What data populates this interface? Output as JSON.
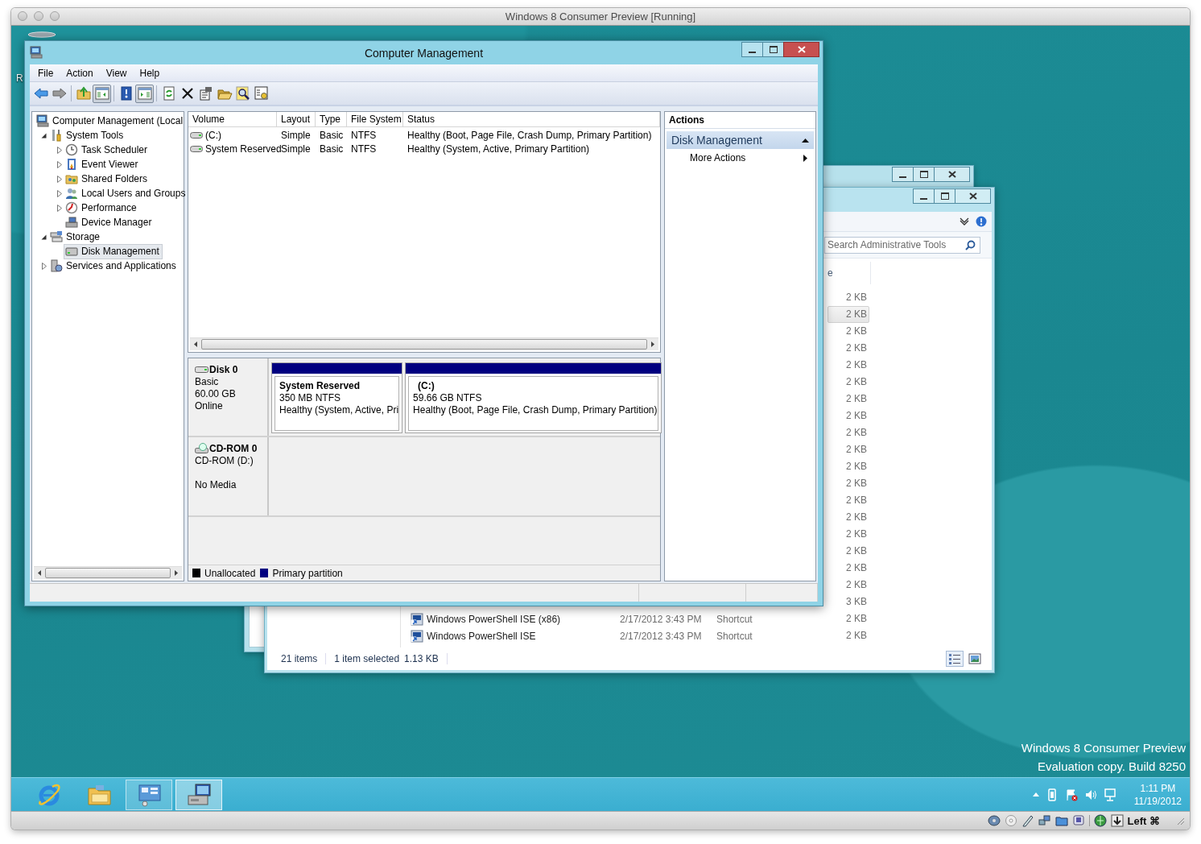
{
  "vm_window": {
    "title": "Windows 8 Consumer Preview [Running]"
  },
  "desktop": {
    "icon_labels": [
      "R"
    ],
    "notice_lines": [
      "Windows 8 Consumer Preview",
      "Evaluation copy. Build 8250"
    ]
  },
  "computer_management": {
    "title": "Computer Management",
    "menu": [
      "File",
      "Action",
      "View",
      "Help"
    ],
    "toolbar_groups": [
      {
        "buttons": [
          {
            "kind": "back",
            "pressed": false
          },
          {
            "kind": "forward",
            "pressed": false
          }
        ]
      },
      {
        "buttons": [
          {
            "kind": "up",
            "pressed": false
          },
          {
            "kind": "console-tree",
            "pressed": true
          }
        ]
      },
      {
        "buttons": [
          {
            "kind": "help",
            "pressed": false
          },
          {
            "kind": "action-pane",
            "pressed": true
          }
        ]
      },
      {
        "buttons": [
          {
            "kind": "refresh",
            "pressed": false
          },
          {
            "kind": "delete",
            "pressed": false
          },
          {
            "kind": "properties",
            "pressed": false
          },
          {
            "kind": "open",
            "pressed": false
          },
          {
            "kind": "search",
            "pressed": false
          },
          {
            "kind": "settings",
            "pressed": false
          }
        ]
      }
    ],
    "tree": [
      {
        "label": "Computer Management (Local",
        "kind": "computer",
        "selected": false,
        "children": [
          {
            "label": "System Tools",
            "kind": "tools",
            "expanded": true,
            "selected": false,
            "children": [
              {
                "label": "Task Scheduler",
                "kind": "scheduler",
                "expanded": false,
                "selected": false
              },
              {
                "label": "Event Viewer",
                "kind": "events",
                "expanded": false,
                "selected": false
              },
              {
                "label": "Shared Folders",
                "kind": "shares",
                "expanded": false,
                "selected": false
              },
              {
                "label": "Local Users and Groups",
                "kind": "users",
                "expanded": false,
                "selected": false
              },
              {
                "label": "Performance",
                "kind": "performance",
                "expanded": false,
                "selected": false
              },
              {
                "label": "Device Manager",
                "kind": "devices",
                "selected": false
              }
            ]
          },
          {
            "label": "Storage",
            "kind": "storage",
            "expanded": true,
            "selected": false,
            "children": [
              {
                "label": "Disk Management",
                "kind": "disks",
                "selected": true
              }
            ]
          },
          {
            "label": "Services and Applications",
            "kind": "services",
            "expanded": false,
            "selected": false
          }
        ]
      }
    ],
    "volumes": {
      "columns": [
        "Volume",
        "Layout",
        "Type",
        "File System",
        "Status"
      ],
      "rows": [
        {
          "cells": [
            "(C:)",
            "Simple",
            "Basic",
            "NTFS",
            "Healthy (Boot, Page File, Crash Dump, Primary Partition)"
          ]
        },
        {
          "cells": [
            "System Reserved",
            "Simple",
            "Basic",
            "NTFS",
            "Healthy (System, Active, Primary Partition)"
          ]
        }
      ]
    },
    "disks": [
      {
        "kind": "disk",
        "name": "Disk 0",
        "lines": [
          "Basic",
          "60.00 GB",
          "Online"
        ],
        "partitions": [
          {
            "name": "System Reserved",
            "size": "350 MB NTFS",
            "status": "Healthy (System, Active, Pri",
            "color": "#000080"
          },
          {
            "name": "(C:)",
            "size": "59.66 GB NTFS",
            "status": "Healthy (Boot, Page File, Crash Dump, Primary Partition)",
            "color": "#000080"
          }
        ]
      },
      {
        "kind": "cdrom",
        "name": "CD-ROM 0",
        "lines": [
          "CD-ROM (D:)",
          "No Media"
        ]
      }
    ],
    "legend": [
      {
        "label": "Unallocated",
        "color": "#000000"
      },
      {
        "label": "Primary partition",
        "color": "#000080"
      }
    ],
    "actions": {
      "title": "Actions",
      "sections": [
        {
          "title": "Disk Management",
          "expanded": true,
          "items": [
            "More Actions"
          ]
        }
      ]
    }
  },
  "admin_tools": {
    "search": {
      "placeholder": "Search Administrative Tools"
    },
    "columns": [
      "e"
    ],
    "rows": [
      {
        "size": "2 KB",
        "selected": false
      },
      {
        "size": "2 KB",
        "selected": true
      },
      {
        "size": "2 KB",
        "selected": false
      },
      {
        "size": "2 KB",
        "selected": false
      },
      {
        "size": "2 KB",
        "selected": false
      },
      {
        "size": "2 KB",
        "selected": false
      },
      {
        "size": "2 KB",
        "selected": false
      },
      {
        "size": "2 KB",
        "selected": false
      },
      {
        "size": "2 KB",
        "selected": false
      },
      {
        "size": "2 KB",
        "selected": false
      },
      {
        "size": "2 KB",
        "selected": false
      },
      {
        "size": "2 KB",
        "selected": false
      },
      {
        "size": "2 KB",
        "selected": false
      },
      {
        "size": "2 KB",
        "selected": false
      },
      {
        "size": "2 KB",
        "selected": false
      },
      {
        "size": "2 KB",
        "selected": false
      },
      {
        "size": "2 KB",
        "selected": false
      },
      {
        "size": "2 KB",
        "selected": false
      },
      {
        "size": "3 KB",
        "selected": false
      },
      {
        "name": "Windows PowerShell ISE (x86)",
        "date": "2/17/2012 3:43 PM",
        "type": "Shortcut",
        "size": "2 KB",
        "selected": false
      },
      {
        "name": "Windows PowerShell ISE",
        "date": "2/17/2012 3:43 PM",
        "type": "Shortcut",
        "size": "2 KB",
        "selected": false
      }
    ],
    "status": {
      "count": "21 items",
      "selection": "1 item selected",
      "selection_size": "1.13 KB"
    },
    "views": [
      {
        "kind": "details",
        "selected": true
      },
      {
        "kind": "large-icons",
        "selected": false
      }
    ]
  },
  "taskbar": {
    "apps": [
      {
        "kind": "browser",
        "running": false,
        "active": false
      },
      {
        "kind": "file-explorer",
        "running": false,
        "active": false
      },
      {
        "kind": "control-panel",
        "running": true,
        "active": false
      },
      {
        "kind": "computer-management",
        "running": true,
        "active": true
      }
    ],
    "clock": {
      "time": "1:11 PM",
      "date": "11/19/2012"
    }
  },
  "vm_status_bar": {
    "host_key": "Left ⌘"
  }
}
